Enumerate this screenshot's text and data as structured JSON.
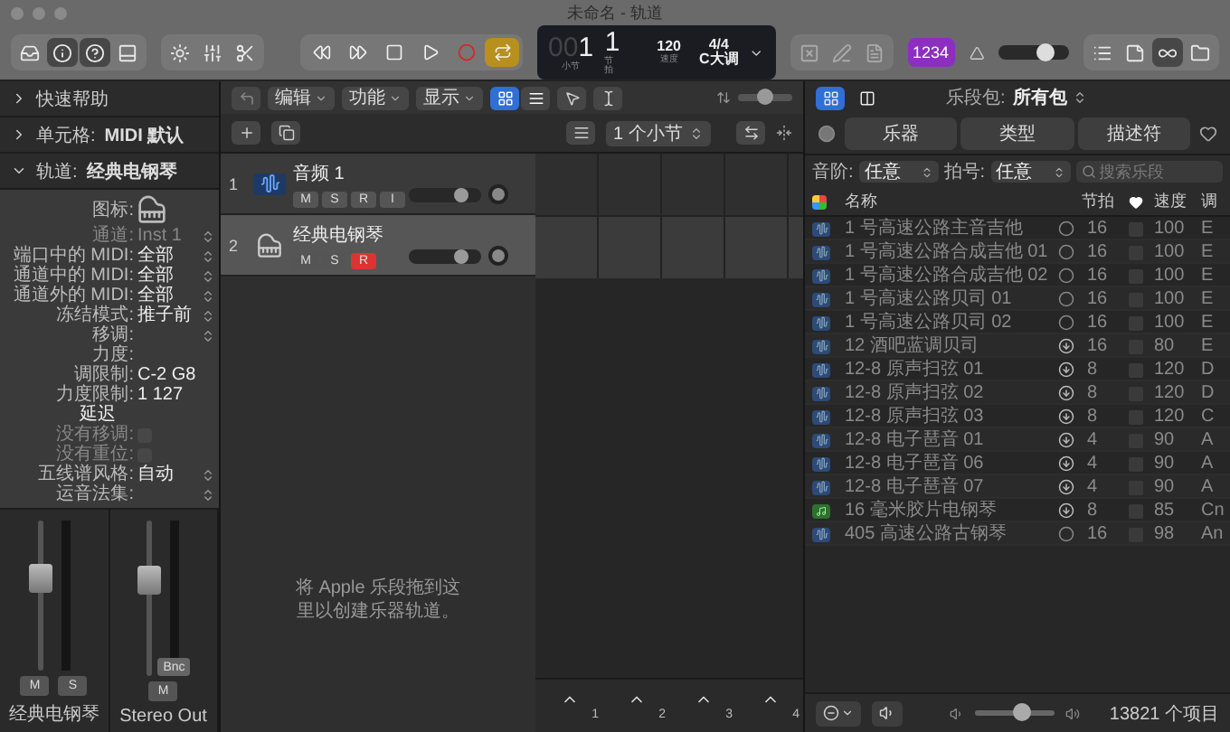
{
  "window": {
    "title": "未命名 - 轨道"
  },
  "toolbar": {
    "view_buttons": [
      {
        "kind": "library",
        "selected": false
      },
      {
        "kind": "info",
        "selected": true
      },
      {
        "kind": "help",
        "selected": true
      },
      {
        "kind": "media",
        "selected": false
      }
    ],
    "panel_buttons": [
      {
        "kind": "smart"
      },
      {
        "kind": "mixer"
      },
      {
        "kind": "editors"
      }
    ],
    "transport": [
      {
        "kind": "rewind"
      },
      {
        "kind": "forward"
      },
      {
        "kind": "stop"
      },
      {
        "kind": "play"
      },
      {
        "kind": "record"
      },
      {
        "kind": "cycle",
        "on": true
      }
    ],
    "lcd": {
      "bar_dim": "00",
      "bar": "1",
      "beat": "1",
      "bar_label": "小节",
      "beat_label": "节拍",
      "tempo": "120",
      "tempo_label": "速度",
      "signature": "4/4",
      "key": "C大调"
    },
    "mode_buttons": [
      {
        "kind": "replace"
      },
      {
        "kind": "tuning"
      },
      {
        "kind": "score"
      }
    ],
    "count_in": {
      "label": "1234",
      "on": true
    },
    "master_volume": {
      "level": 0.68
    },
    "window_buttons": [
      {
        "kind": "list",
        "selected": false
      },
      {
        "kind": "notes",
        "selected": false
      },
      {
        "kind": "loops",
        "selected": true
      },
      {
        "kind": "browser",
        "selected": false
      }
    ]
  },
  "inspector": {
    "sections": [
      {
        "label": "快速帮助",
        "expanded": false
      },
      {
        "label": "单元格:",
        "value": "MIDI 默认",
        "expanded": false
      },
      {
        "label": "轨道:",
        "value": "经典电钢琴",
        "expanded": true
      }
    ],
    "params": [
      {
        "kind": "icon",
        "label": "图标:"
      },
      {
        "kind": "select",
        "label": "通道:",
        "value": "Inst 1",
        "disabled": true
      },
      {
        "kind": "select",
        "label": "端口中的 MIDI:",
        "value": "全部",
        "disabled": false
      },
      {
        "kind": "select",
        "label": "通道中的 MIDI:",
        "value": "全部",
        "disabled": false
      },
      {
        "kind": "select",
        "label": "通道外的 MIDI:",
        "value": "全部",
        "disabled": false
      },
      {
        "kind": "select",
        "label": "冻结模式:",
        "value": "推子前",
        "disabled": false
      },
      {
        "kind": "select",
        "label": "移调:",
        "disabled": false
      },
      {
        "kind": "text",
        "label": "力度:",
        "disabled": false
      },
      {
        "kind": "text",
        "label": "调限制:",
        "value": "C-2  G8",
        "disabled": false
      },
      {
        "kind": "text",
        "label": "力度限制:",
        "value": "1  127",
        "disabled": false
      },
      {
        "kind": "header",
        "label": "延迟"
      },
      {
        "kind": "checkbox",
        "label": "没有移调:",
        "checked": false,
        "disabled": true
      },
      {
        "kind": "checkbox",
        "label": "没有重位:",
        "checked": false,
        "disabled": true
      },
      {
        "kind": "select",
        "label": "五线谱风格:",
        "value": "自动",
        "disabled": false
      },
      {
        "kind": "select",
        "label": "运音法集:",
        "disabled": false
      }
    ],
    "strips": [
      {
        "name": "经典电钢琴",
        "level": 0.62,
        "buttons": [
          "M",
          "S"
        ]
      },
      {
        "name": "Stereo Out",
        "level": 0.62,
        "buttons": [
          "M"
        ],
        "bounce": "Bnc"
      }
    ]
  },
  "tracks": {
    "menus": [
      "编辑",
      "功能",
      "显示"
    ],
    "views": [
      {
        "kind": "grid",
        "selected": true
      },
      {
        "kind": "list",
        "selected": false
      }
    ],
    "snap": "1 个小节",
    "zoom": {
      "level": 0.5
    },
    "rows": [
      {
        "number": "1",
        "name": "音频 1",
        "kind": "audio",
        "selected": false,
        "level": 0.72,
        "buttons": [
          {
            "label": "M",
            "on": false
          },
          {
            "label": "S",
            "on": false
          },
          {
            "label": "R",
            "on": false
          },
          {
            "label": "I",
            "on": false
          }
        ]
      },
      {
        "number": "2",
        "name": "经典电钢琴",
        "kind": "instrument",
        "selected": true,
        "level": 0.72,
        "buttons": [
          {
            "label": "M",
            "on": false
          },
          {
            "label": "S",
            "on": false
          },
          {
            "label": "R",
            "on": true
          }
        ]
      }
    ],
    "hint": "将 Apple 乐段拖到这里以创建乐器轨道。",
    "markers": [
      "1",
      "2",
      "3",
      "4"
    ]
  },
  "library": {
    "pack_label": "乐段包:",
    "pack": "所有包",
    "views": [
      {
        "kind": "grid",
        "selected": true
      },
      {
        "kind": "columns",
        "selected": false
      }
    ],
    "filters": [
      {
        "label": "乐器",
        "selected": false
      },
      {
        "label": "类型",
        "selected": false
      },
      {
        "label": "描述符",
        "selected": false
      }
    ],
    "scale_label": "音阶:",
    "scale": "任意",
    "signature_label": "拍号:",
    "signature": "任意",
    "search": {
      "placeholder": "搜索乐段"
    },
    "columns": [
      "名称",
      "节拍",
      "速度",
      "调"
    ],
    "rows": [
      {
        "kind": "audio",
        "name": "1 号高速公路主音吉他",
        "downloaded": true,
        "beats": "16",
        "favorite": false,
        "tempo": "100",
        "key": "E"
      },
      {
        "kind": "audio",
        "name": "1 号高速公路合成吉他 01",
        "downloaded": true,
        "beats": "16",
        "favorite": false,
        "tempo": "100",
        "key": "E"
      },
      {
        "kind": "audio",
        "name": "1 号高速公路合成吉他 02",
        "downloaded": true,
        "beats": "16",
        "favorite": false,
        "tempo": "100",
        "key": "E"
      },
      {
        "kind": "audio",
        "name": "1 号高速公路贝司 01",
        "downloaded": true,
        "beats": "16",
        "favorite": false,
        "tempo": "100",
        "key": "E"
      },
      {
        "kind": "audio",
        "name": "1 号高速公路贝司 02",
        "downloaded": true,
        "beats": "16",
        "favorite": false,
        "tempo": "100",
        "key": "E"
      },
      {
        "kind": "audio",
        "name": "12 酒吧蓝调贝司",
        "downloaded": false,
        "beats": "16",
        "favorite": false,
        "tempo": "80",
        "key": "E"
      },
      {
        "kind": "audio",
        "name": "12-8 原声扫弦 01",
        "downloaded": false,
        "beats": "8",
        "favorite": false,
        "tempo": "120",
        "key": "D"
      },
      {
        "kind": "audio",
        "name": "12-8 原声扫弦 02",
        "downloaded": false,
        "beats": "8",
        "favorite": false,
        "tempo": "120",
        "key": "D"
      },
      {
        "kind": "audio",
        "name": "12-8 原声扫弦 03",
        "downloaded": false,
        "beats": "8",
        "favorite": false,
        "tempo": "120",
        "key": "C"
      },
      {
        "kind": "audio",
        "name": "12-8 电子琶音 01",
        "downloaded": false,
        "beats": "4",
        "favorite": false,
        "tempo": "90",
        "key": "A"
      },
      {
        "kind": "audio",
        "name": "12-8 电子琶音 06",
        "downloaded": false,
        "beats": "4",
        "favorite": false,
        "tempo": "90",
        "key": "A"
      },
      {
        "kind": "audio",
        "name": "12-8 电子琶音 07",
        "downloaded": false,
        "beats": "4",
        "favorite": false,
        "tempo": "90",
        "key": "A"
      },
      {
        "kind": "midi",
        "name": "16 毫米胶片电钢琴",
        "downloaded": false,
        "beats": "8",
        "favorite": false,
        "tempo": "85",
        "key": "Cn"
      },
      {
        "kind": "audio",
        "name": "405 高速公路古钢琴",
        "downloaded": true,
        "beats": "16",
        "favorite": false,
        "tempo": "98",
        "key": "An"
      }
    ],
    "preview_volume": {
      "level": 0.6
    },
    "count": "13821 个项目"
  }
}
